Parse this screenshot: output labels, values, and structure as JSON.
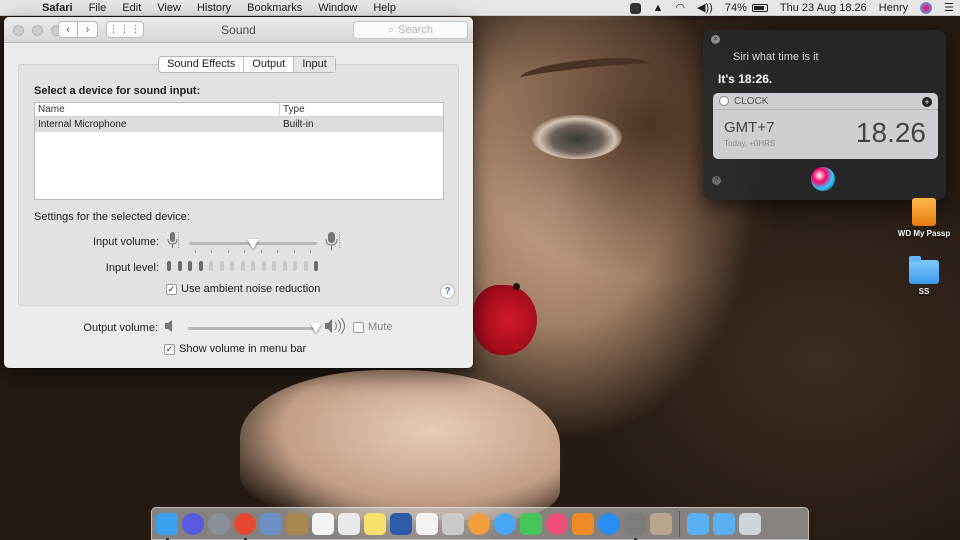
{
  "menubar": {
    "apple_glyph": "",
    "app_name": "Safari",
    "items": [
      "File",
      "Edit",
      "View",
      "History",
      "Bookmarks",
      "Window",
      "Help"
    ],
    "battery": "74%",
    "clock": "Thu 23 Aug  18.26",
    "user": "Henry"
  },
  "sound_window": {
    "title": "Sound",
    "search_placeholder": "Search",
    "tabs": [
      "Sound Effects",
      "Output",
      "Input"
    ],
    "active_tab": "Input",
    "section_title": "Select a device for sound input:",
    "table": {
      "columns": [
        "Name",
        "Type"
      ],
      "rows": [
        {
          "name": "Internal Microphone",
          "type": "Built-in"
        }
      ]
    },
    "settings_label": "Settings for the selected device:",
    "input_volume_label": "Input volume:",
    "input_volume_level": 0.5,
    "input_level_label": "Input level:",
    "input_level_bars_total": 15,
    "input_level_bars_on": [
      0,
      1,
      2,
      3,
      14
    ],
    "ambient_noise_label": "Use ambient noise reduction",
    "ambient_noise_checked": true,
    "help_glyph": "?",
    "output_volume_label": "Output volume:",
    "output_volume_level": 1.0,
    "mute_label": "Mute",
    "mute_checked": false,
    "show_volume_label": "Show volume in menu bar",
    "show_volume_checked": true
  },
  "siri": {
    "question": "Siri what time is it",
    "answer": "It's 18:26.",
    "card": {
      "app": "CLOCK",
      "timezone": "GMT+7",
      "subtitle": "Today, +0HRS",
      "time": "18.26"
    }
  },
  "desktop": {
    "icons": [
      {
        "label": "WD My Passp",
        "kind": "drive"
      },
      {
        "label": "SS",
        "kind": "folder"
      }
    ]
  },
  "dock": {
    "apps": [
      {
        "name": "finder-icon",
        "color": "#3aa0f0",
        "running": true
      },
      {
        "name": "siri-icon",
        "color": "#5a5ae0",
        "running": false,
        "round": true
      },
      {
        "name": "launchpad-icon",
        "color": "#8a8f99",
        "running": false,
        "round": true
      },
      {
        "name": "chrome-icon",
        "color": "#e5472f",
        "running": true,
        "round": true
      },
      {
        "name": "preview-icon",
        "color": "#6b8fc2",
        "running": false
      },
      {
        "name": "notefile-icon",
        "color": "#a9874f",
        "running": false
      },
      {
        "name": "calendar-icon",
        "color": "#f4f4f4",
        "running": false
      },
      {
        "name": "textedit-icon",
        "color": "#e9e9e9",
        "running": false
      },
      {
        "name": "notes-icon",
        "color": "#f7df6b",
        "running": false
      },
      {
        "name": "keynote-icon",
        "color": "#2f5ca8",
        "running": false
      },
      {
        "name": "reminders-icon",
        "color": "#f3f3f3",
        "running": false
      },
      {
        "name": "script-editor-icon",
        "color": "#c9c9c9",
        "running": false
      },
      {
        "name": "photos-icon",
        "color": "#f39c3c",
        "running": false,
        "round": true
      },
      {
        "name": "messages-icon",
        "color": "#47a6f5",
        "running": false,
        "round": true
      },
      {
        "name": "facetime-icon",
        "color": "#46c55b",
        "running": false
      },
      {
        "name": "itunes-icon",
        "color": "#f04e7a",
        "running": false,
        "round": true
      },
      {
        "name": "ibooks-icon",
        "color": "#f08a24",
        "running": false
      },
      {
        "name": "app-store-icon",
        "color": "#2a8ef0",
        "running": false,
        "round": true
      },
      {
        "name": "system-preferences-icon",
        "color": "#7d7d7d",
        "running": true
      },
      {
        "name": "archive-utility-icon",
        "color": "#b7a58c",
        "running": false
      },
      {
        "name": "applications-folder-icon",
        "color": "#5ab0f0",
        "running": false
      },
      {
        "name": "downloads-folder-icon",
        "color": "#5ab0f0",
        "running": false
      },
      {
        "name": "trash-icon",
        "color": "#cfd4d8",
        "running": false
      }
    ]
  },
  "colors": {
    "accent": "#2d7ae6",
    "window_bg": "#ececec",
    "siri_bg": "#28282a"
  }
}
